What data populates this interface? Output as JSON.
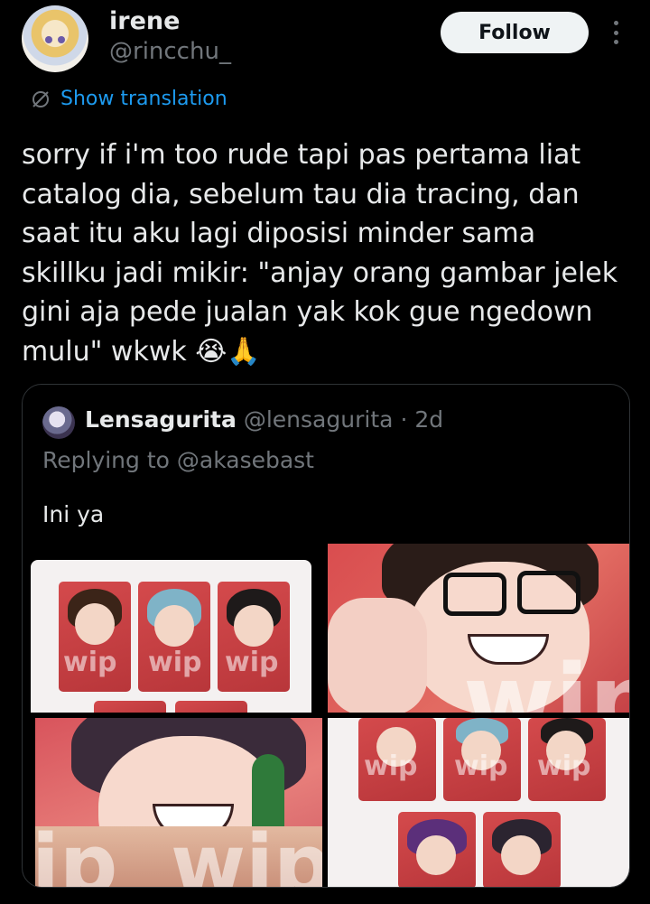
{
  "author": {
    "name": "irene",
    "handle": "@rincchu_"
  },
  "actions": {
    "follow_label": "Follow"
  },
  "translation": {
    "label": "Show translation"
  },
  "tweet": {
    "text": "sorry if i'm too rude tapi pas pertama liat\ncatalog dia, sebelum tau dia tracing, dan\nsaat itu aku lagi diposisi minder sama\nskillku jadi mikir: \"anjay orang gambar jelek\ngini aja pede jualan yak kok gue ngedown\nmulu\" wkwk 😭🙏"
  },
  "quoted": {
    "name": "Lensagurita",
    "handle": "@lensagurita",
    "separator": "·",
    "time": "2d",
    "replying_to": "Replying to @akasebast",
    "text": "Ini ya",
    "watermarks": {
      "small": "wip",
      "large": "wip",
      "partial": "ip"
    }
  },
  "colors": {
    "background": "#000000",
    "link": "#1d9bf0",
    "secondary_text": "#71767b",
    "follow_bg": "#eff3f4"
  },
  "icons": [
    "more-options-icon",
    "translate-icon"
  ]
}
